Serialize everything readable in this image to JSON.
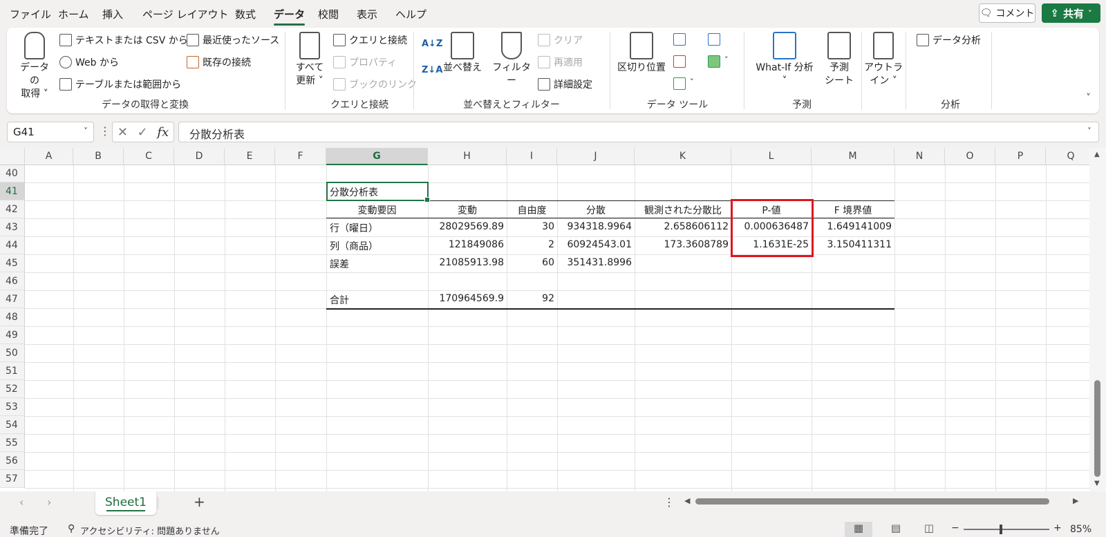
{
  "menu": {
    "items": [
      "ファイル",
      "ホーム",
      "挿入",
      "ページ レイアウト",
      "数式",
      "データ",
      "校閲",
      "表示",
      "ヘルプ"
    ],
    "active": "データ",
    "comment_label": "コメント",
    "share_label": "共有"
  },
  "ribbon": {
    "get_data": "データの\n取得 ˅",
    "text_csv": "テキストまたは CSV から",
    "web": "Web から",
    "table_range": "テーブルまたは範囲から",
    "recent_sources": "最近使ったソース",
    "existing_conn": "既存の接続",
    "group_get": "データの取得と変換",
    "refresh_all": "すべて\n更新 ˅",
    "queries_conn": "クエリと接続",
    "properties": "プロパティ",
    "edit_links": "ブックのリンク",
    "group_queries": "クエリと接続",
    "sort_az": "A↓Z",
    "sort_za": "Z↓A",
    "sort": "並べ替え",
    "filter": "フィルター",
    "clear": "クリア",
    "reapply": "再適用",
    "advanced": "詳細設定",
    "group_sort": "並べ替えとフィルター",
    "text_to_columns": "区切り位置",
    "group_tools": "データ ツール",
    "whatif": "What-If 分析\n˅",
    "forecast_sheet": "予測\nシート",
    "group_forecast": "予測",
    "outline": "アウトラ\nイン ˅",
    "data_analysis": "データ分析",
    "group_analysis": "分析"
  },
  "formula_bar": {
    "name_box": "G41",
    "formula": "分散分析表"
  },
  "columns": [
    "A",
    "B",
    "C",
    "D",
    "E",
    "F",
    "G",
    "H",
    "I",
    "J",
    "K",
    "L",
    "M",
    "N",
    "O",
    "P",
    "Q"
  ],
  "selected_column": "G",
  "rows": [
    "40",
    "41",
    "42",
    "43",
    "44",
    "45",
    "46",
    "47",
    "48",
    "49",
    "50",
    "51",
    "52",
    "53",
    "54",
    "55",
    "56",
    "57"
  ],
  "selected_row": "41",
  "anova": {
    "title": "分散分析表",
    "headers": [
      "変動要因",
      "変動",
      "自由度",
      "分散",
      "観測された分散比",
      "P-値",
      "F 境界値"
    ],
    "rows": [
      [
        "行（曜日）",
        "28029569.89",
        "30",
        "934318.9964",
        "2.658606112",
        "0.000636487",
        "1.649141009"
      ],
      [
        "列（商品）",
        "121849086",
        "2",
        "60924543.01",
        "173.3608789",
        "1.1631E-25",
        "3.150411311"
      ],
      [
        "誤差",
        "21085913.98",
        "60",
        "351431.8996",
        "",
        "",
        ""
      ],
      [
        "",
        "",
        "",
        "",
        "",
        "",
        ""
      ],
      [
        "合計",
        "170964569.9",
        "92",
        "",
        "",
        "",
        ""
      ]
    ]
  },
  "sheets": {
    "active": "Sheet1",
    "add_label": "+"
  },
  "status": {
    "ready": "準備完了",
    "accessibility": "アクセシビリティ: 問題ありません",
    "zoom": "85%",
    "zoom_minus": "−",
    "zoom_plus": "+"
  }
}
